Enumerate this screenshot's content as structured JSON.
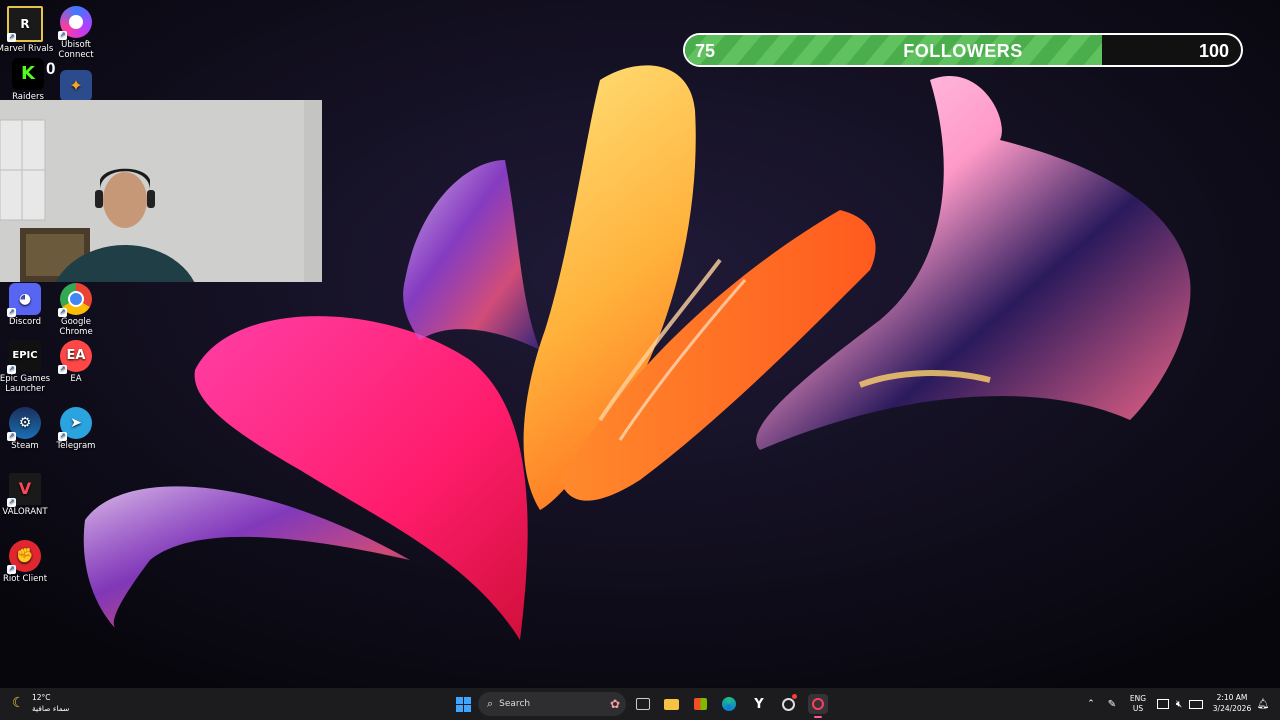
{
  "desktop_icons": [
    {
      "label": "Marvel Rivals",
      "icon": "marvel-rivals-icon"
    },
    {
      "label": "Ubisoft Connect",
      "icon": "ubisoft-connect-icon"
    },
    {
      "label": "Discord",
      "icon": "discord-icon"
    },
    {
      "label": "Google Chrome",
      "icon": "chrome-icon"
    },
    {
      "label": "Epic Games Launcher",
      "icon": "epic-games-icon"
    },
    {
      "label": "EA",
      "icon": "ea-icon"
    },
    {
      "label": "Steam",
      "icon": "steam-icon"
    },
    {
      "label": "Telegram",
      "icon": "telegram-icon"
    },
    {
      "label": "VALORANT",
      "icon": "valorant-icon"
    },
    {
      "label": "Riot Client",
      "icon": "riot-client-icon"
    }
  ],
  "partial_icons": {
    "kick_count": "0",
    "kick_sub": "Raiders"
  },
  "followers_goal": {
    "current": "75",
    "label": "FOLLOWERS",
    "target": "100",
    "fraction": 0.75,
    "fill_color": "#55b956"
  },
  "taskbar": {
    "weather_temp": "12°C",
    "weather_desc": "سماء صافية",
    "search_placeholder": "Search",
    "language": "ENG",
    "region": "US",
    "time": "2:10 AM",
    "date": "3/24/2026"
  }
}
